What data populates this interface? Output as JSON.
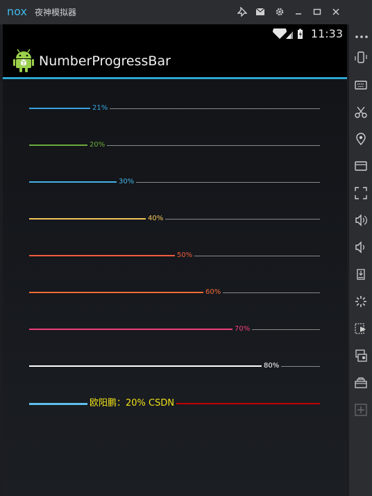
{
  "emulator": {
    "app_name": "夜神模拟器",
    "logo_text": "nox"
  },
  "status_bar": {
    "time": "11:33"
  },
  "action_bar": {
    "title": "NumberProgressBar"
  },
  "progress_bars": [
    {
      "value": 21,
      "label": "21%",
      "color": "#3aa3df"
    },
    {
      "value": 20,
      "label": "20%",
      "color": "#6dab3a"
    },
    {
      "value": 30,
      "label": "30%",
      "color": "#43b3e6"
    },
    {
      "value": 40,
      "label": "40%",
      "color": "#f7c65a"
    },
    {
      "value": 50,
      "label": "50%",
      "color": "#ef5d3f"
    },
    {
      "value": 60,
      "label": "60%",
      "color": "#f26b36"
    },
    {
      "value": 70,
      "label": "70%",
      "color": "#f23e7b"
    },
    {
      "value": 80,
      "label": "80%",
      "color": "#ffffff"
    }
  ],
  "custom_bar": {
    "value": 20,
    "label": "欧阳鹏：20%  CSDN",
    "reached_color": "#5fc0ef",
    "unreached_color": "#c40000",
    "text_color": "#f1e21a"
  }
}
